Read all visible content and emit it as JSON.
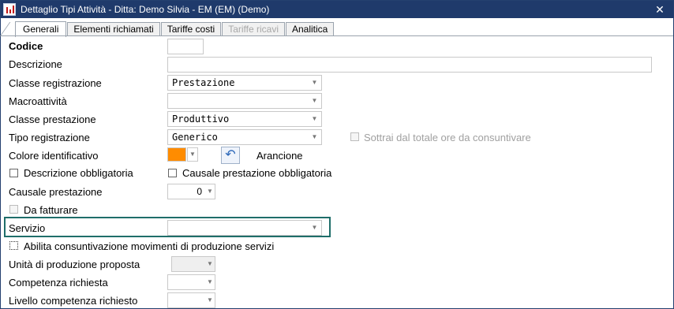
{
  "window": {
    "title": "Dettaglio Tipi Attività - Ditta: Demo Silvia - EM (EM) (Demo)",
    "close_glyph": "✕"
  },
  "tabs": [
    {
      "label": "Generali",
      "state": "active"
    },
    {
      "label": "Elementi richiamati",
      "state": "normal"
    },
    {
      "label": "Tariffe costi",
      "state": "normal"
    },
    {
      "label": "Tariffe ricavi",
      "state": "disabled"
    },
    {
      "label": "Analitica",
      "state": "normal"
    }
  ],
  "form": {
    "codice": {
      "label": "Codice",
      "value": ""
    },
    "descrizione": {
      "label": "Descrizione",
      "value": ""
    },
    "classe_registrazione": {
      "label": "Classe registrazione",
      "value": "Prestazione"
    },
    "macroattivita": {
      "label": "Macroattività",
      "value": ""
    },
    "classe_prestazione": {
      "label": "Classe prestazione",
      "value": "Produttivo"
    },
    "tipo_registrazione": {
      "label": "Tipo registrazione",
      "value": "Generico"
    },
    "sottrai": {
      "label": "Sottrai dal totale ore da consuntivare",
      "checked": false
    },
    "colore": {
      "label": "Colore identificativo",
      "color": "#ff8c00",
      "color_name": "Arancione",
      "reset_icon": "undo-icon"
    },
    "descrizione_obbligatoria": {
      "label": "Descrizione obbligatoria",
      "checked": false
    },
    "causale_obbligatoria": {
      "label": "Causale prestazione obbligatoria",
      "checked": false
    },
    "causale_prestazione": {
      "label": "Causale prestazione",
      "value": "0"
    },
    "da_fatturare": {
      "label": "Da fatturare",
      "checked": false
    },
    "servizio": {
      "label": "Servizio",
      "value": ""
    },
    "abilita_consuntivazione": {
      "label": "Abilita consuntivazione movimenti di produzione servizi",
      "checked": false
    },
    "unita_produzione": {
      "label": "Unità di produzione proposta",
      "value": ""
    },
    "competenza_richiesta": {
      "label": "Competenza richiesta",
      "value": ""
    },
    "livello_competenza": {
      "label": "Livello competenza richiesto",
      "value": ""
    }
  },
  "colors": {
    "title_bar": "#1f3a6b",
    "highlight_border": "#1f6e6a",
    "swatch": "#ff8c00"
  }
}
